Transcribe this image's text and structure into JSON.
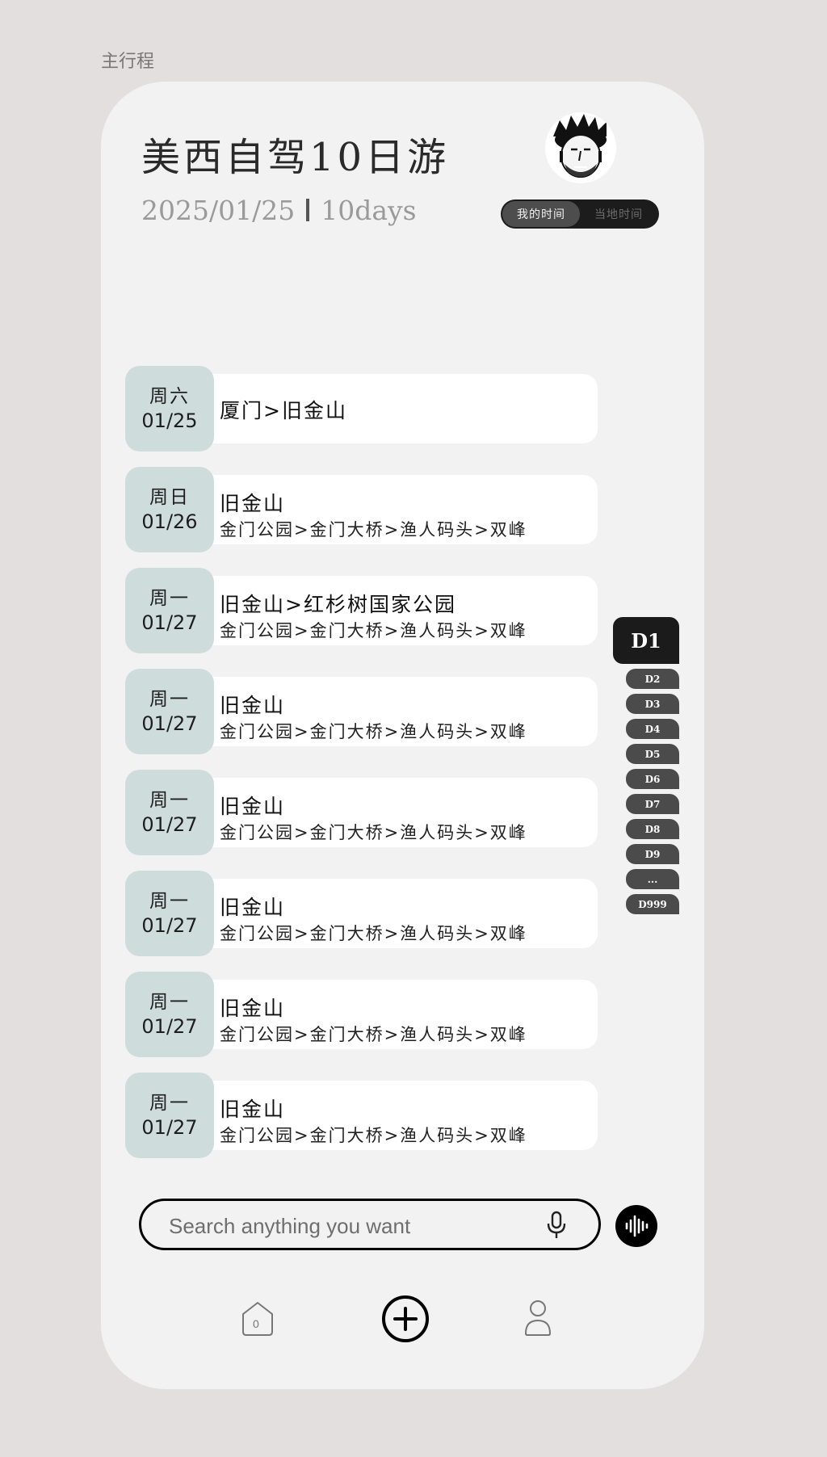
{
  "page_label": "主行程",
  "trip": {
    "title": "美西自驾10日游",
    "start_date": "2025/01/25",
    "duration": "10days"
  },
  "time_toggle": {
    "options": [
      "我的时间",
      "当地时间"
    ],
    "active": "我的时间"
  },
  "days": [
    {
      "weekday": "周六",
      "date": "01/25",
      "city": "厦门>旧金山",
      "spots": ""
    },
    {
      "weekday": "周日",
      "date": "01/26",
      "city": "旧金山",
      "spots": "金门公园>金门大桥>渔人码头>双峰"
    },
    {
      "weekday": "周一",
      "date": "01/27",
      "city": "旧金山>红杉树国家公园",
      "spots": "金门公园>金门大桥>渔人码头>双峰"
    },
    {
      "weekday": "周一",
      "date": "01/27",
      "city": "旧金山",
      "spots": "金门公园>金门大桥>渔人码头>双峰"
    },
    {
      "weekday": "周一",
      "date": "01/27",
      "city": "旧金山",
      "spots": "金门公园>金门大桥>渔人码头>双峰"
    },
    {
      "weekday": "周一",
      "date": "01/27",
      "city": "旧金山",
      "spots": "金门公园>金门大桥>渔人码头>双峰"
    },
    {
      "weekday": "周一",
      "date": "01/27",
      "city": "旧金山",
      "spots": "金门公园>金门大桥>渔人码头>双峰"
    },
    {
      "weekday": "周一",
      "date": "01/27",
      "city": "旧金山",
      "spots": "金门公园>金门大桥>渔人码头>双峰"
    }
  ],
  "day_index": {
    "current": "D1",
    "tabs": [
      "D2",
      "D3",
      "D4",
      "D5",
      "D6",
      "D7",
      "D8",
      "D9",
      "...",
      "D999"
    ]
  },
  "search": {
    "placeholder": "Search anything you want",
    "value": ""
  },
  "nav": {
    "home_badge": "0",
    "icons": [
      "home-icon",
      "add-circle-icon",
      "profile-icon"
    ]
  },
  "icons": {
    "search_mic": "microphone-icon",
    "voice": "voice-wave-icon",
    "avatar": "avatar-cartoon-face"
  },
  "colors": {
    "background": "#e4dfdf",
    "card": "#f2f2f2",
    "date_chip": "#cfdcdc",
    "accent_dark": "#1b1b1b"
  }
}
